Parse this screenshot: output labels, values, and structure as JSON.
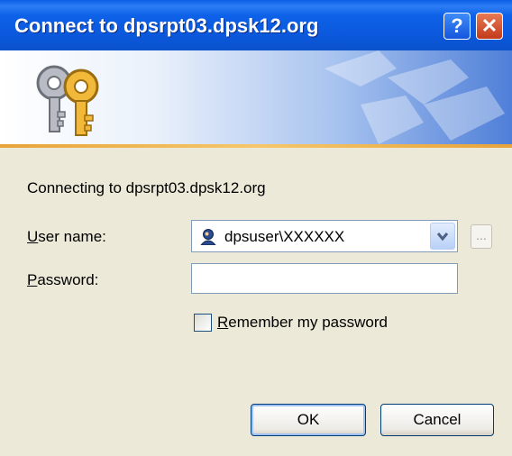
{
  "dialog": {
    "title": "Connect to dpsrpt03.dpsk12.org",
    "help_glyph": "?",
    "close_glyph": "✕",
    "connecting_text": "Connecting to dpsrpt03.dpsk12.org"
  },
  "form": {
    "username_label_key": "U",
    "username_label_rest": "ser name:",
    "username_value": "dpsuser\\XXXXXX",
    "browse_label": "...",
    "password_label_key": "P",
    "password_label_rest": "assword:",
    "password_value": "",
    "remember_key": "R",
    "remember_rest": "emember my password",
    "remember_checked": false
  },
  "buttons": {
    "ok_label": "OK",
    "cancel_label": "Cancel"
  },
  "icons": {
    "banner": "keys-icon",
    "user": "user-avatar-icon",
    "dropdown": "chevron-down-icon"
  },
  "colors": {
    "titlebar": "#0b58dc",
    "dialog_bg": "#ece9d8",
    "accent_line": "#e8a33a",
    "close_button": "#c23a1a"
  }
}
